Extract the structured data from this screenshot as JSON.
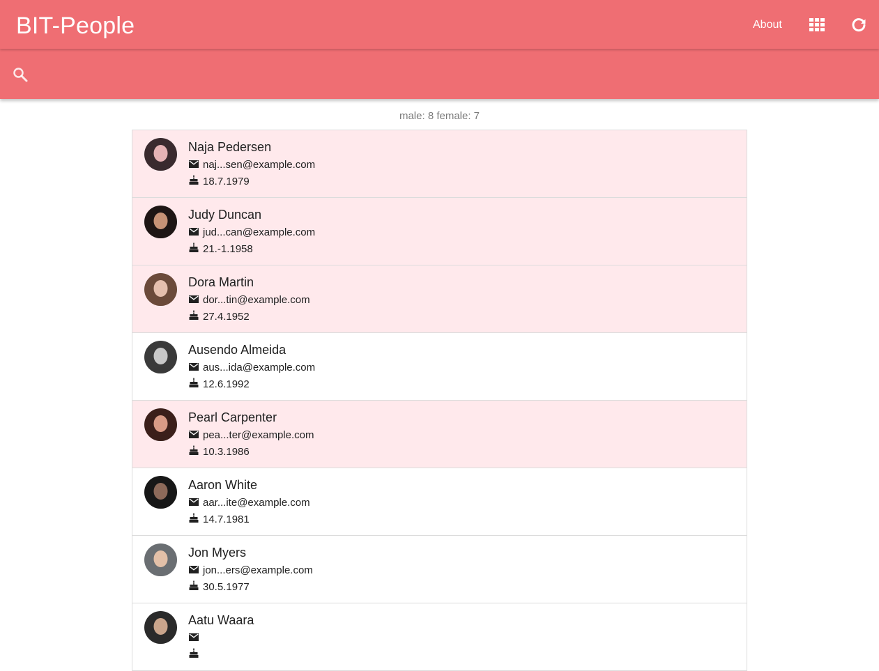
{
  "header": {
    "brand": "BIT-People",
    "about_label": "About",
    "grid_icon": "grid-view-icon",
    "reload_icon": "refresh-icon"
  },
  "search": {
    "icon": "search-icon",
    "value": "",
    "placeholder": ""
  },
  "stats": {
    "text": "male: 8 female: 7"
  },
  "colors": {
    "brand": "#ef6e73",
    "female_row": "#ffe9ec",
    "male_row": "#ffffff"
  },
  "people": [
    {
      "name": "Naja Pedersen",
      "email": "naj...sen@example.com",
      "dob": "18.7.1979",
      "gender": "female",
      "avatar_colors": [
        "#3a2a2e",
        "#e6b3b5"
      ]
    },
    {
      "name": "Judy Duncan",
      "email": "jud...can@example.com",
      "dob": "21.-1.1958",
      "gender": "female",
      "avatar_colors": [
        "#1e1514",
        "#c79276"
      ]
    },
    {
      "name": "Dora Martin",
      "email": "dor...tin@example.com",
      "dob": "27.4.1952",
      "gender": "female",
      "avatar_colors": [
        "#6b4a3a",
        "#e5bfae"
      ]
    },
    {
      "name": "Ausendo Almeida",
      "email": "aus...ida@example.com",
      "dob": "12.6.1992",
      "gender": "male",
      "avatar_colors": [
        "#3a3a3a",
        "#c8c8c8"
      ]
    },
    {
      "name": "Pearl Carpenter",
      "email": "pea...ter@example.com",
      "dob": "10.3.1986",
      "gender": "female",
      "avatar_colors": [
        "#3b1f1a",
        "#d99b86"
      ]
    },
    {
      "name": "Aaron White",
      "email": "aar...ite@example.com",
      "dob": "14.7.1981",
      "gender": "male",
      "avatar_colors": [
        "#171717",
        "#8d6a5a"
      ]
    },
    {
      "name": "Jon Myers",
      "email": "jon...ers@example.com",
      "dob": "30.5.1977",
      "gender": "male",
      "avatar_colors": [
        "#6a6e72",
        "#e3c0a8"
      ]
    },
    {
      "name": "Aatu Waara",
      "email": "",
      "dob": "",
      "gender": "male",
      "avatar_colors": [
        "#2a2a2a",
        "#caa58c"
      ]
    }
  ]
}
